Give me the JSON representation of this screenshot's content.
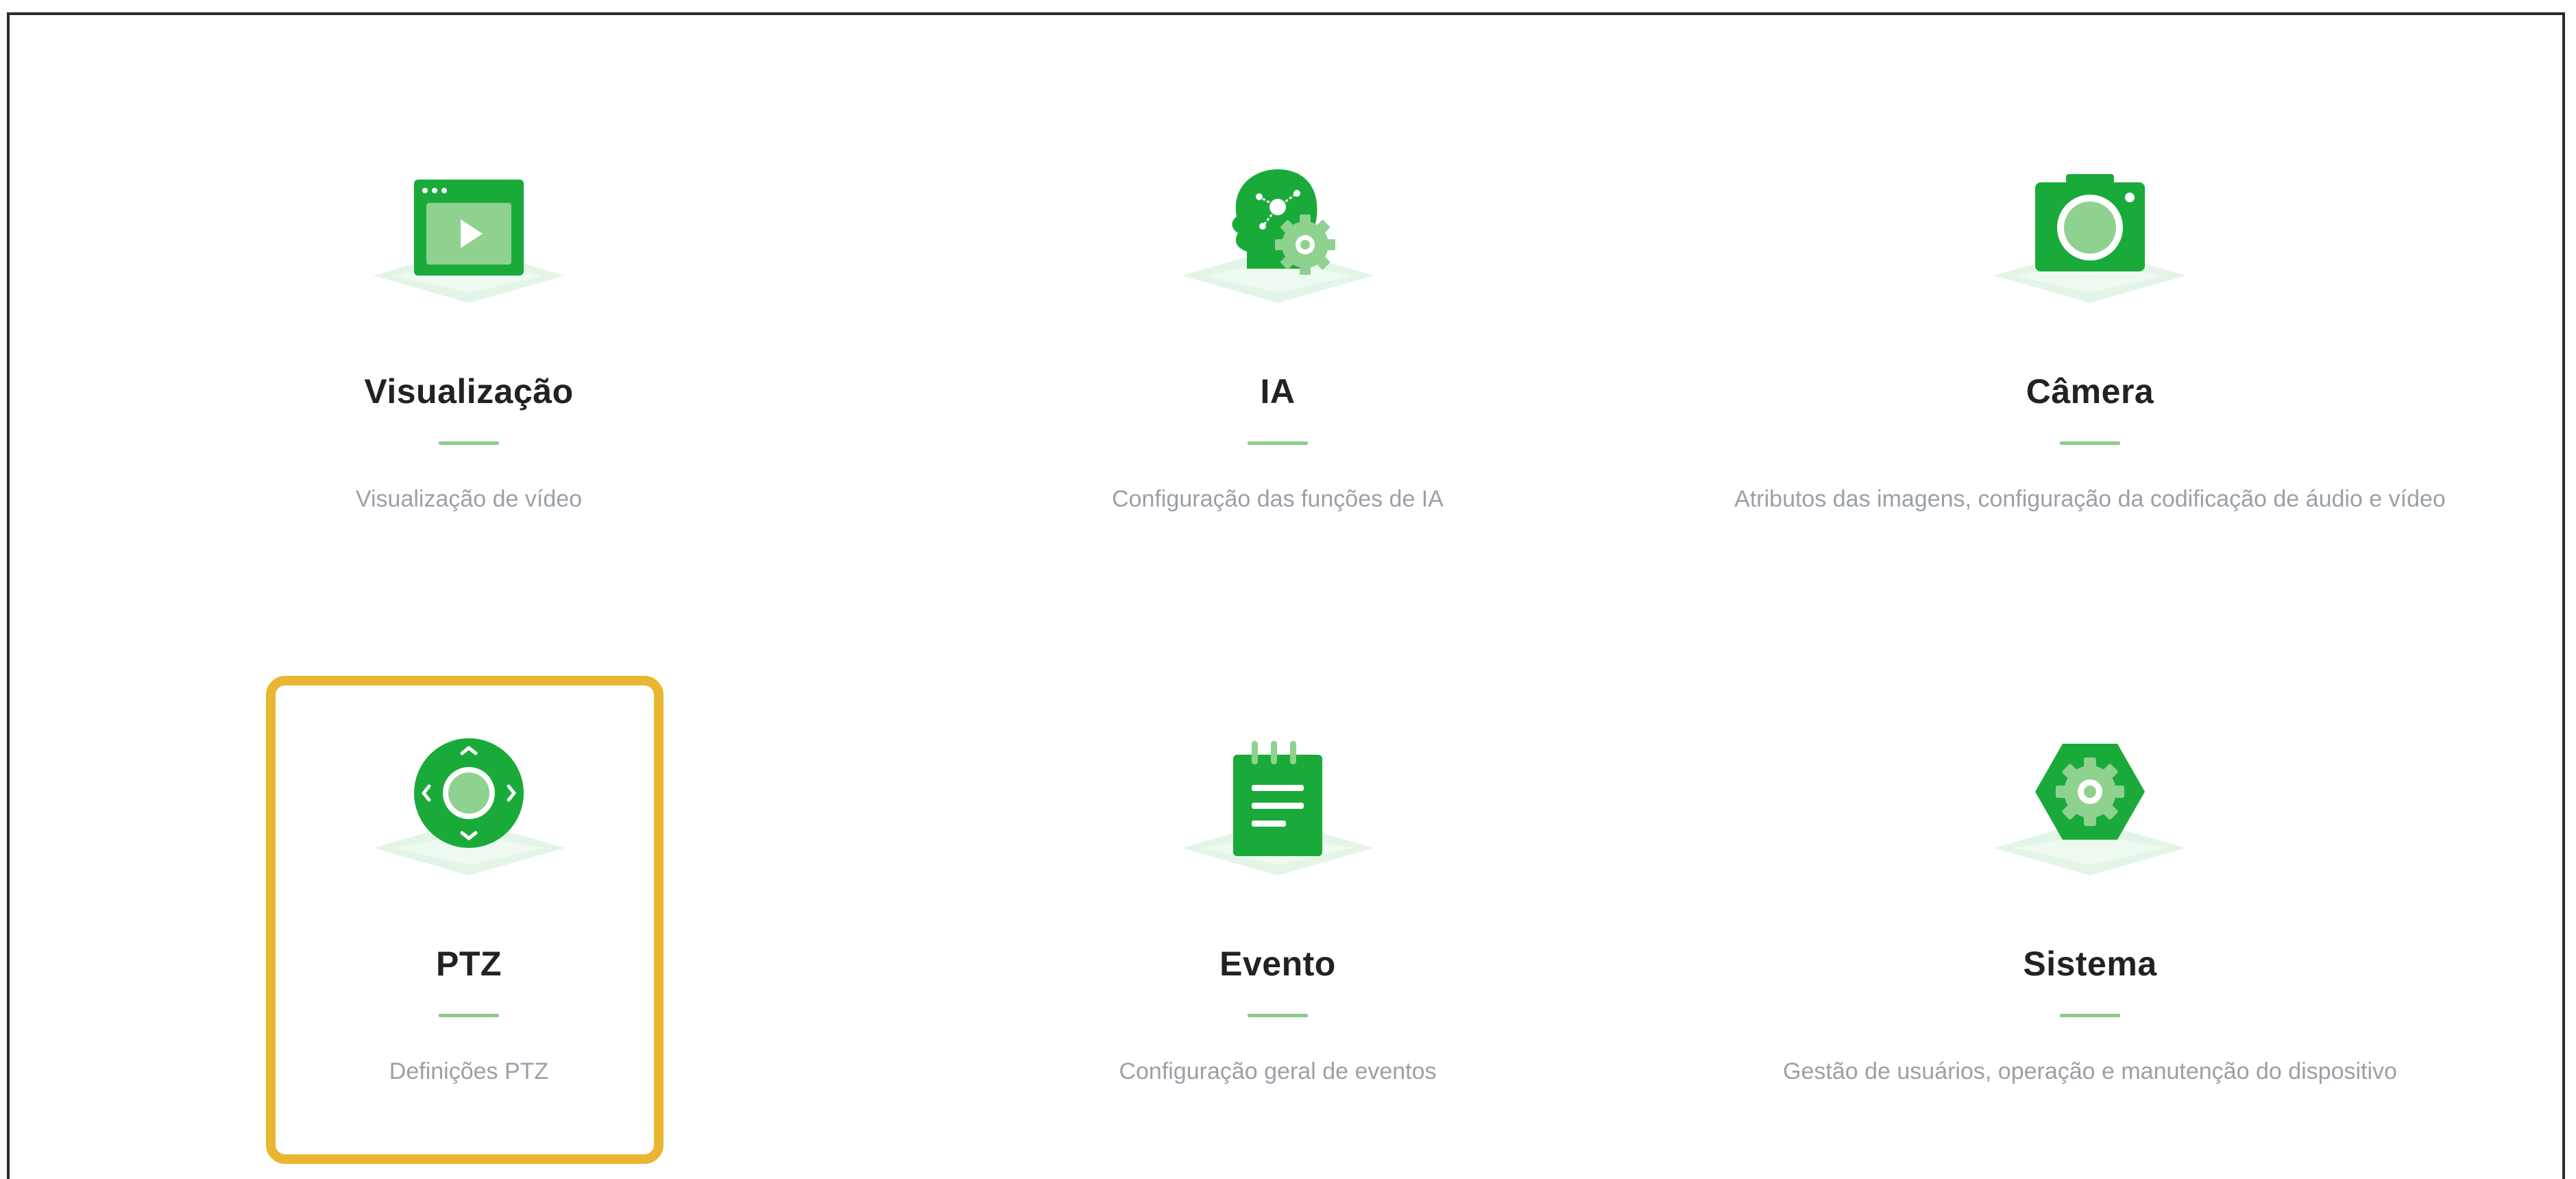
{
  "colors": {
    "accent": "#1aaa3a",
    "accent_light": "#8fd18f",
    "base_tile": "#e3f5e6",
    "title": "#222222",
    "description": "#9aa0a8",
    "divider": "#8cc98c",
    "highlight": "#e8b631"
  },
  "cards": [
    {
      "icon": "video-player-icon",
      "title": "Visualização",
      "description": "Visualização de vídeo"
    },
    {
      "icon": "ai-head-gear-icon",
      "title": "IA",
      "description": "Configuração das funções de IA"
    },
    {
      "icon": "camera-icon",
      "title": "Câmera",
      "description": "Atributos das imagens, configuração da codificação de áudio e vídeo"
    },
    {
      "icon": "ptz-joystick-icon",
      "title": "PTZ",
      "description": "Definições PTZ",
      "selected": true
    },
    {
      "icon": "notepad-icon",
      "title": "Evento",
      "description": "Configuração geral de eventos"
    },
    {
      "icon": "hexagon-gear-icon",
      "title": "Sistema",
      "description": "Gestão de usuários, operação e manutenção do dispositivo"
    }
  ]
}
